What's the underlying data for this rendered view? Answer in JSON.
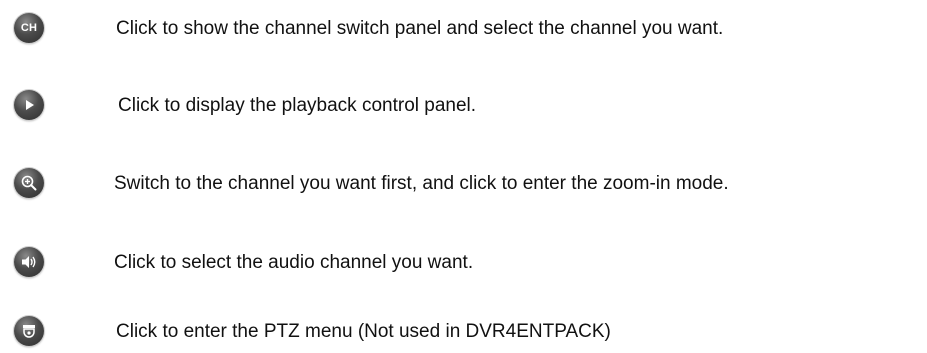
{
  "items": [
    {
      "icon": "channel-switch-icon",
      "icon_text": "CH",
      "text": "Click to show the channel switch panel and select the channel you want."
    },
    {
      "icon": "playback-icon",
      "text": "Click to display the playback control panel."
    },
    {
      "icon": "zoom-in-icon",
      "text": "Switch to the channel you want first, and click to enter the zoom-in mode."
    },
    {
      "icon": "audio-icon",
      "text": "Click to select the audio channel you want."
    },
    {
      "icon": "ptz-icon",
      "text": "Click to enter the PTZ menu (Not used in DVR4ENTPACK)"
    }
  ]
}
